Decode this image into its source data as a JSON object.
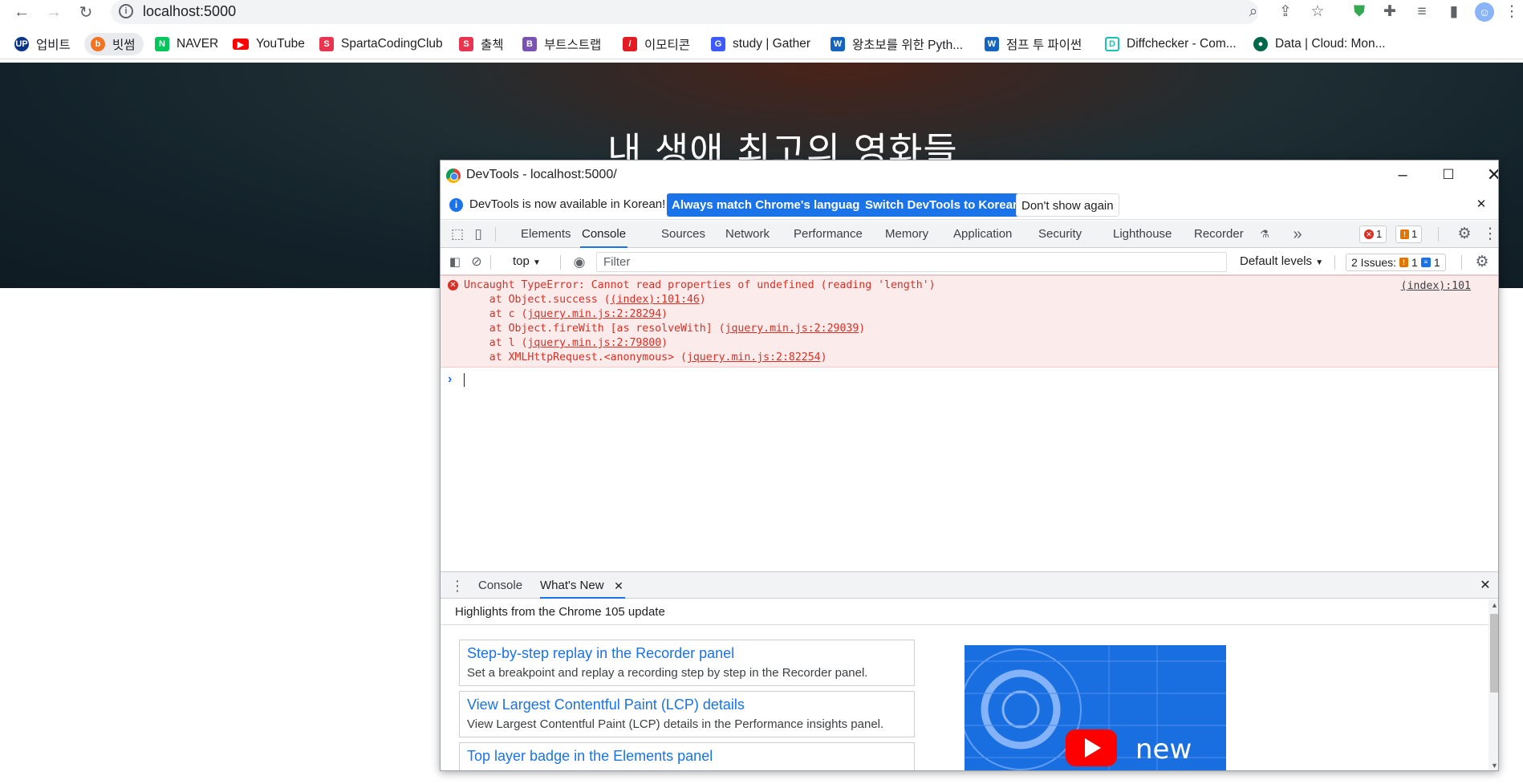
{
  "browser": {
    "url": "localhost:5000",
    "bookmarks": [
      {
        "label": "업비트",
        "color": "#093687",
        "glyph": "UP"
      },
      {
        "label": "빗썸",
        "color": "#f37321",
        "glyph": "b"
      },
      {
        "label": "NAVER",
        "color": "#03c75a",
        "glyph": "N"
      },
      {
        "label": "YouTube",
        "color": "#ff0000",
        "glyph": "▶"
      },
      {
        "label": "SpartaCodingClub",
        "color": "#e8344e",
        "glyph": "S"
      },
      {
        "label": "출첵",
        "color": "#e8344e",
        "glyph": "S"
      },
      {
        "label": "부트스트랩",
        "color": "#7952b3",
        "glyph": "B"
      },
      {
        "label": "이모티콘",
        "color": "#e31b23",
        "glyph": "/"
      },
      {
        "label": "study | Gather",
        "color": "#3d5afe",
        "glyph": "G"
      },
      {
        "label": "왕초보를 위한 Pyth...",
        "color": "#1565c0",
        "glyph": "W"
      },
      {
        "label": "점프 투 파이썬",
        "color": "#1565c0",
        "glyph": "W"
      },
      {
        "label": "Diffchecker - Com...",
        "color": "#17c3b2",
        "glyph": "D"
      },
      {
        "label": "Data | Cloud: Mon...",
        "color": "#13aa52",
        "glyph": "●"
      }
    ]
  },
  "page": {
    "hero_title": "내 생애 최고의 영화들"
  },
  "devtools": {
    "window_title": "DevTools - localhost:5000/",
    "infobar": {
      "text": "DevTools is now available in Korean!",
      "btn_match": "Always match Chrome's language",
      "btn_switch": "Switch DevTools to Korean",
      "btn_dismiss": "Don't show again"
    },
    "tabs": [
      "Elements",
      "Console",
      "Sources",
      "Network",
      "Performance",
      "Memory",
      "Application",
      "Security",
      "Lighthouse",
      "Recorder"
    ],
    "active_tab": "Console",
    "error_count": "1",
    "warning_count": "1",
    "toolbar": {
      "context": "top",
      "filter_placeholder": "Filter",
      "levels": "Default levels",
      "issues_label": "2 Issues:",
      "issues_warn": "1",
      "issues_info": "1"
    },
    "error": {
      "message": "Uncaught TypeError: Cannot read properties of undefined (reading 'length')",
      "source": "(index):101",
      "stack": [
        {
          "pre": "    at Object.success (",
          "link": "(index):101:46",
          "post": ")"
        },
        {
          "pre": "    at c (",
          "link": "jquery.min.js:2:28294",
          "post": ")"
        },
        {
          "pre": "    at Object.fireWith [as resolveWith] (",
          "link": "jquery.min.js:2:29039",
          "post": ")"
        },
        {
          "pre": "    at l (",
          "link": "jquery.min.js:2:79800",
          "post": ")"
        },
        {
          "pre": "    at XMLHttpRequest.<anonymous> (",
          "link": "jquery.min.js:2:82254",
          "post": ")"
        }
      ]
    },
    "drawer": {
      "tab_console": "Console",
      "tab_whats_new": "What's New",
      "header": "Highlights from the Chrome 105 update",
      "cards": [
        {
          "title": "Step-by-step replay in the Recorder panel",
          "desc": "Set a breakpoint and replay a recording step by step in the Recorder panel."
        },
        {
          "title": "View Largest Contentful Paint (LCP) details",
          "desc": "View Largest Contentful Paint (LCP) details in the Performance insights panel."
        },
        {
          "title": "Top layer badge in the Elements panel",
          "desc": ""
        }
      ],
      "video_label": "new"
    }
  }
}
